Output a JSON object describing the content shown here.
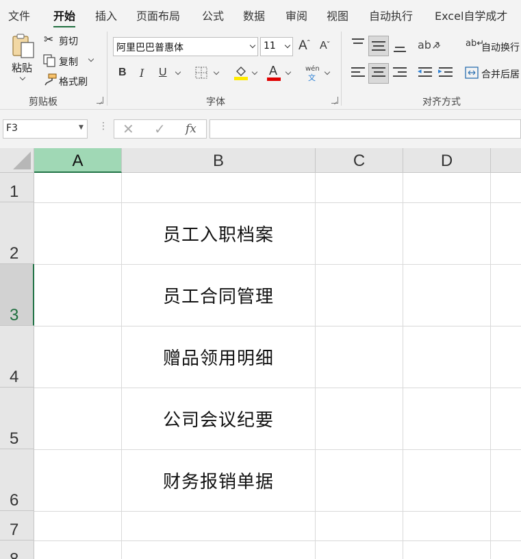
{
  "ribbon": {
    "tabs": [
      {
        "label": "文件"
      },
      {
        "label": "开始"
      },
      {
        "label": "插入"
      },
      {
        "label": "页面布局"
      },
      {
        "label": "公式"
      },
      {
        "label": "数据"
      },
      {
        "label": "审阅"
      },
      {
        "label": "视图"
      },
      {
        "label": "自动执行"
      },
      {
        "label": "Excel自学成才"
      }
    ],
    "active_tab": "开始",
    "clipboard": {
      "paste": "粘贴",
      "cut": "剪切",
      "copy": "复制",
      "format_painter": "格式刷",
      "group_label": "剪贴板"
    },
    "font": {
      "font_name": "阿里巴巴普惠体",
      "font_size": "11",
      "bold": "B",
      "italic": "I",
      "underline": "U",
      "grow": "A",
      "shrink": "A",
      "font_color_letter": "A",
      "phonetic_top": "wén",
      "phonetic_bottom": "文",
      "group_label": "字体",
      "fill_color": "#ffeb00",
      "font_color": "#e00000"
    },
    "alignment": {
      "wrap_text": "自动换行",
      "merge_center": "合并后居",
      "group_label": "对齐方式"
    }
  },
  "formula_bar": {
    "name_box": "F3",
    "fx": "fx",
    "formula": ""
  },
  "sheet": {
    "columns": [
      "A",
      "B",
      "C",
      "D"
    ],
    "selected_column": "A",
    "rows": [
      "1",
      "2",
      "3",
      "4",
      "5",
      "6",
      "7",
      "8"
    ],
    "selected_row": "3",
    "cells_b": [
      "",
      "员工入职档案",
      "员工合同管理",
      "赠品领用明细",
      "公司会议纪要",
      "财务报销单据",
      "",
      ""
    ]
  }
}
